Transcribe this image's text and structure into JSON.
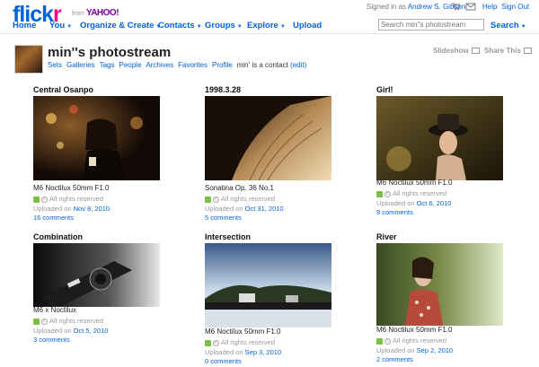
{
  "header": {
    "logo_part1": "flick",
    "logo_part2": "r",
    "from_label": "from",
    "yahoo_label": "YAHOO!",
    "signed_in_prefix": "Signed in as",
    "user_name": "Andrew S. Gibson",
    "help": "Help",
    "sign_out": "Sign Out"
  },
  "nav": {
    "home": "Home",
    "you": "You",
    "organize": "Organize & Create",
    "contacts": "Contacts",
    "groups": "Groups",
    "explore": "Explore",
    "upload": "Upload",
    "search_placeholder": "Search min''s photostream",
    "search": "Search"
  },
  "profile": {
    "title": "min''s photostream",
    "links": [
      "Sets",
      "Galleries",
      "Tags",
      "People",
      "Archives",
      "Favorites",
      "Profile"
    ],
    "contact_text": "min' is a contact",
    "edit": "(edit)",
    "slideshow": "Slideshow",
    "share": "Share This"
  },
  "photos": [
    {
      "title": "Central Osanpo",
      "caption": "M6 Noctilux 50mm F1.0",
      "rights": "All rights reserved",
      "uploaded_prefix": "Uploaded on",
      "date": "Nov 8, 2010",
      "comments": "16 comments"
    },
    {
      "title": "1998.3.28",
      "caption": "Sonatina Op. 36 No.1",
      "rights": "All rights reserved",
      "uploaded_prefix": "Uploaded on",
      "date": "Oct 31, 2010",
      "comments": "5 comments"
    },
    {
      "title": "Girl!",
      "caption": "M6 Noctilux 50mm F1.0",
      "rights": "All rights reserved",
      "uploaded_prefix": "Uploaded on",
      "date": "Oct 6, 2010",
      "comments": "9 comments"
    },
    {
      "title": "Combination",
      "caption": "M6 x Noctilux",
      "rights": "All rights reserved",
      "uploaded_prefix": "Uploaded on",
      "date": "Oct 5, 2010",
      "comments": "3 comments"
    },
    {
      "title": "Intersection",
      "caption": "M6 Noctilux 50mm F1.0",
      "rights": "All rights reserved",
      "uploaded_prefix": "Uploaded on",
      "date": "Sep 3, 2010",
      "comments": "0 comments"
    },
    {
      "title": "River",
      "caption": "M6 Noctilux 50mm F1.0",
      "rights": "All rights reserved",
      "uploaded_prefix": "Uploaded on",
      "date": "Sep 2, 2010",
      "comments": "2 comments"
    }
  ],
  "colors": {
    "link_blue": "#0063dc",
    "flickr_pink": "#ff0084",
    "license_green": "#7ac142"
  }
}
